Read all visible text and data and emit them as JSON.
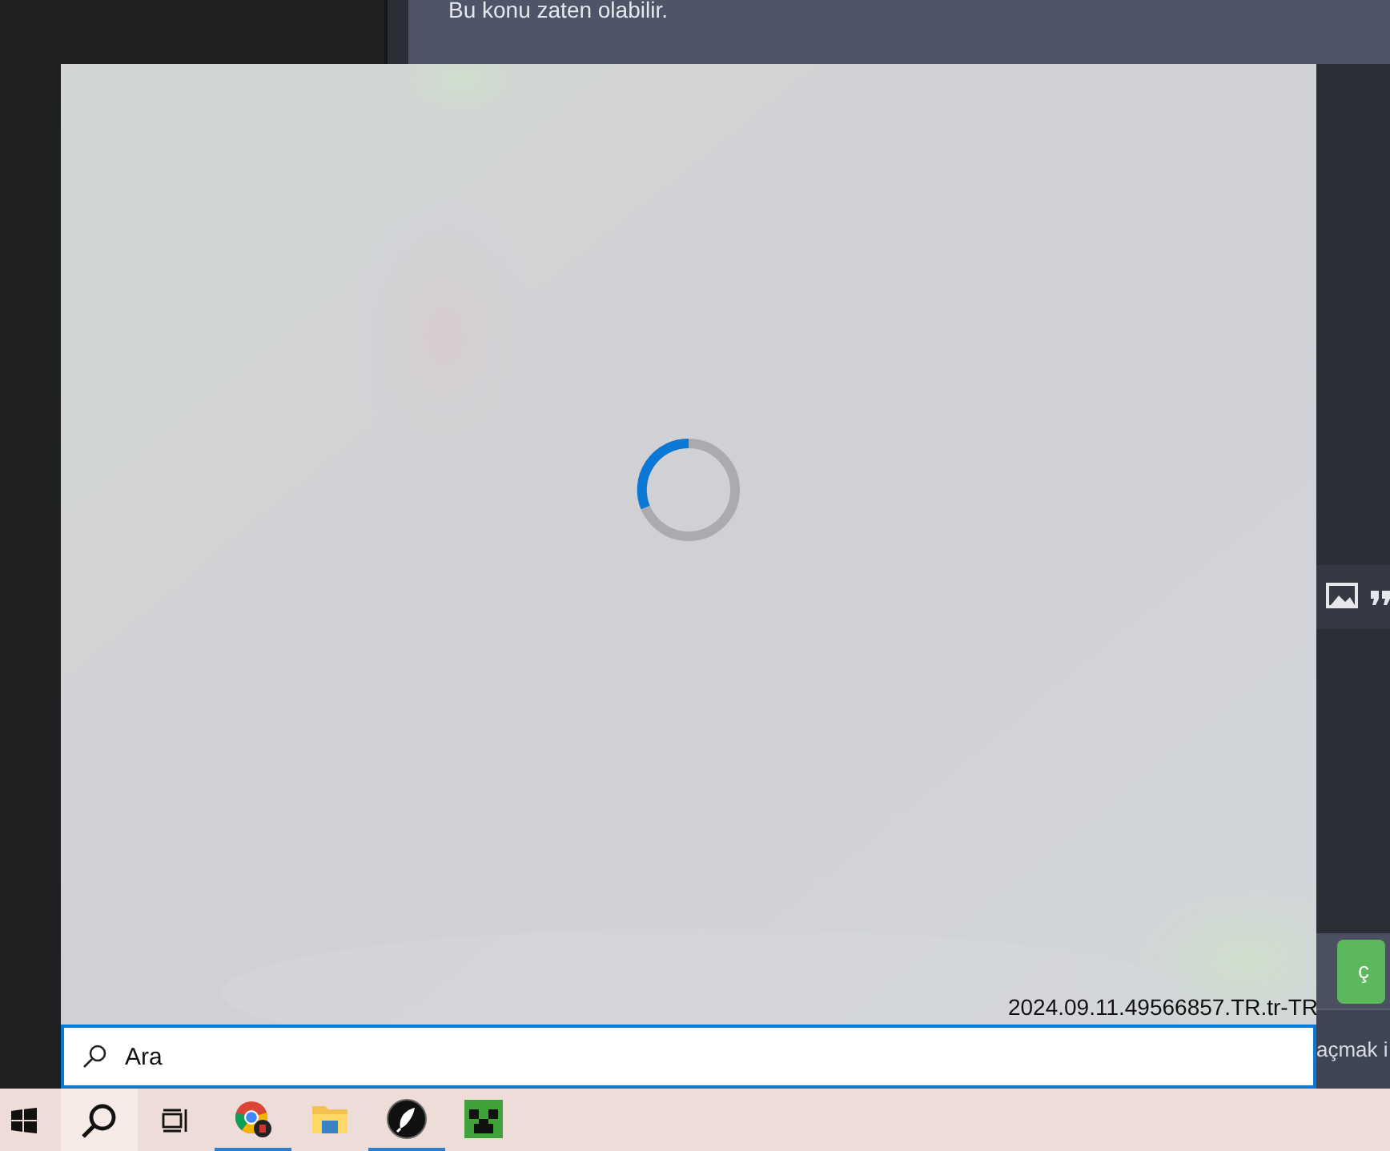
{
  "background_page": {
    "notice": "Bu konu zaten olabilir.",
    "submit_button": "ç",
    "footer_text": "açmak i"
  },
  "search_flyout": {
    "loading": true,
    "version": "2024.09.11.49566857.TR.tr-TR",
    "search": {
      "placeholder": "Ara"
    }
  },
  "taskbar": {
    "search_selected": true,
    "apps": [
      {
        "kind": "browser",
        "running": true
      },
      {
        "kind": "folder",
        "running": false
      },
      {
        "kind": "quill",
        "running": true
      },
      {
        "kind": "creeper",
        "running": false
      }
    ]
  }
}
